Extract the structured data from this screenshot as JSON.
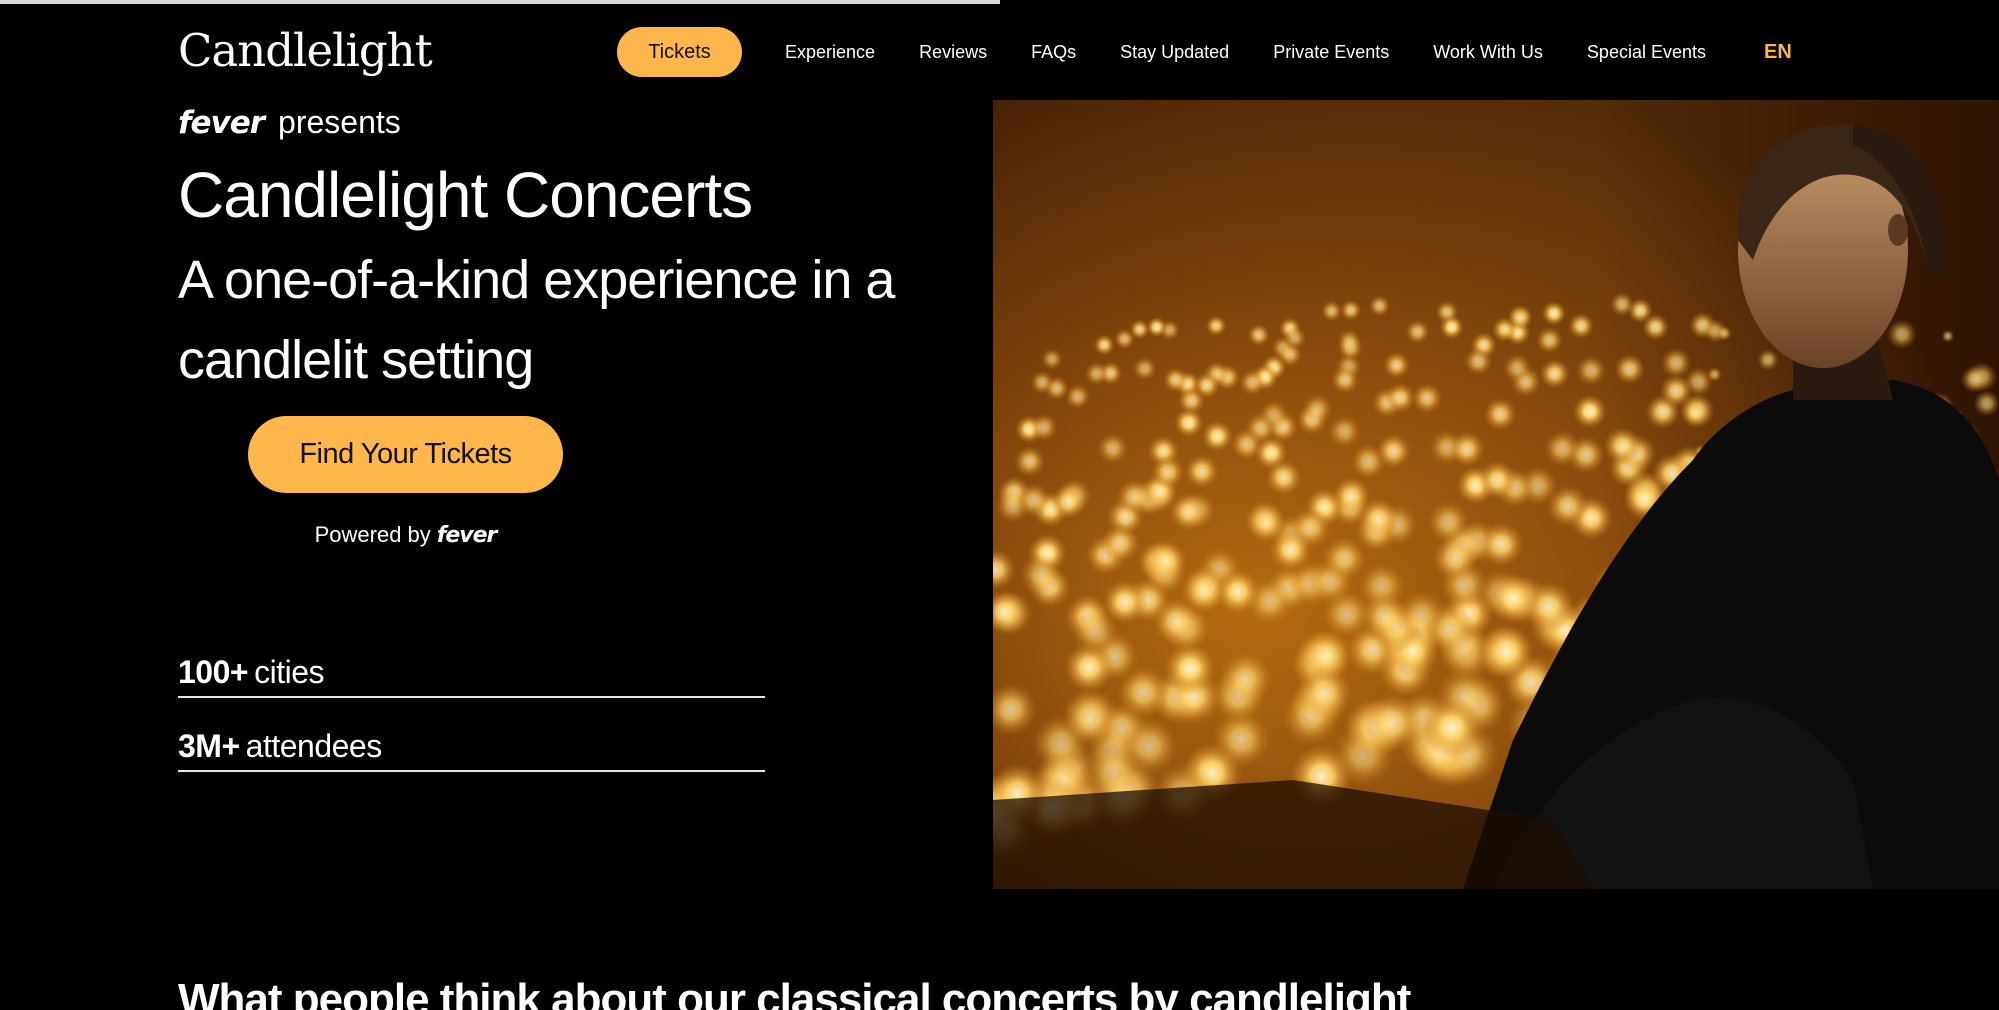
{
  "header": {
    "logo_text": "Candlelight",
    "nav": {
      "tickets": "Tickets",
      "experience": "Experience",
      "reviews": "Reviews",
      "faqs": "FAQs",
      "stay_updated": "Stay Updated",
      "private_events": "Private Events",
      "work_with_us": "Work With Us",
      "special_events": "Special Events",
      "language": "EN"
    }
  },
  "hero": {
    "brand": "fever",
    "presents": "presents",
    "title": "Candlelight Concerts",
    "subtitle": "A one-of-a-kind experience in a candlelit setting",
    "cta_label": "Find Your Tickets",
    "powered_by": "Powered by",
    "powered_brand": "fever",
    "stats": [
      {
        "value": "100+",
        "label": "cities"
      },
      {
        "value": "3M+",
        "label": "attendees"
      }
    ],
    "image_description_icon": "photo"
  },
  "next_section": {
    "heading": "What people think about our classical concerts by candlelight"
  },
  "colors": {
    "accent": "#ffb74c",
    "background": "#000000",
    "text": "#ffffff"
  }
}
